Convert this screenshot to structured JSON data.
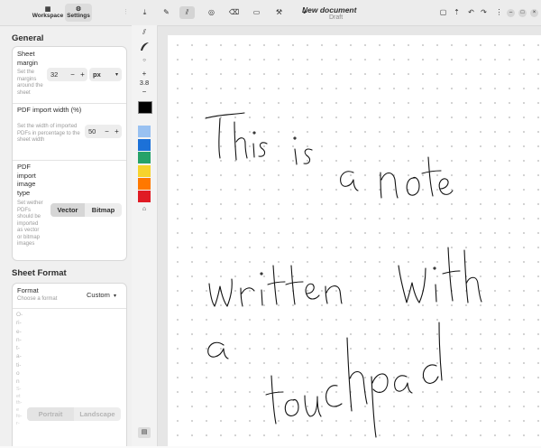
{
  "sidebar": {
    "tabs": [
      {
        "label": "Workspace",
        "icon": "workspace-icon"
      },
      {
        "label": "Settings",
        "icon": "gear-icon"
      }
    ],
    "general": {
      "title": "General",
      "sheet_margin": {
        "title": "Sheet margin",
        "subtitle": "Set the margins around the sheet",
        "value": "32",
        "unit": "px"
      },
      "pdf_import_width": {
        "title": "PDF import width (%)",
        "subtitle": "Set the width of imported PDFs in percentage to the sheet width",
        "value": "50"
      },
      "pdf_import_type": {
        "title": "PDF import image type",
        "subtitle": "Set wether PDFs should be imported as vector or bitmap images",
        "options": [
          "Vector",
          "Bitmap"
        ],
        "selected": "Vector"
      }
    },
    "sheet_format": {
      "title": "Sheet Format",
      "format": {
        "title": "Format",
        "subtitle": "Choose a format",
        "value": "Custom"
      },
      "orientation": {
        "label_fragments": [
          "O-",
          "ri-",
          "e-",
          "n-",
          "t-",
          "a-",
          "ti-",
          "o",
          "n"
        ],
        "subtitle_fragments": [
          "S-",
          "et",
          "th-",
          "e",
          "fo-",
          "r-"
        ],
        "options": [
          "Portrait",
          "Landscape"
        ],
        "selected": "Portrait"
      }
    }
  },
  "header": {
    "title": "New document",
    "subtitle": "Draft",
    "modified_marker": "•"
  },
  "tools": {
    "stroke_width": "3.8"
  },
  "colors": {
    "swatches": [
      "#000000",
      "#99c1f1",
      "#1c71d8",
      "#26a269",
      "#f6d32d",
      "#ff7800",
      "#e01b24"
    ],
    "accent": "#3584e4"
  },
  "note": {
    "lines": [
      "This is a note",
      "written with",
      "a",
      "touchpad"
    ]
  }
}
